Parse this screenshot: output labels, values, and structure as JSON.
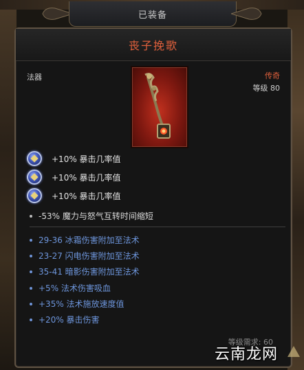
{
  "header": {
    "equipped_label": "已装备"
  },
  "item": {
    "name": "丧子挽歌",
    "type": "法器",
    "rarity": "传奇",
    "level": "等级 80",
    "icon": "scepter-icon"
  },
  "gem_mods": [
    {
      "text": "+10% 暴击几率值",
      "icon": "blue-gem-icon"
    },
    {
      "text": "+10% 暴击几率值",
      "icon": "blue-gem-icon"
    },
    {
      "text": "+10% 暴击几率值",
      "icon": "blue-gem-icon"
    }
  ],
  "implicit_mods": [
    {
      "text": "-53% 魔力与怒气互转时间缩短"
    }
  ],
  "affixes": [
    {
      "text": "29-36 冰霜伤害附加至法术"
    },
    {
      "text": "23-27 闪电伤害附加至法术"
    },
    {
      "text": "35-41 暗影伤害附加至法术"
    },
    {
      "text": "+5% 法术伤害吸血"
    },
    {
      "text": "+35% 法术施放速度值"
    },
    {
      "text": "+20% 暴击伤害"
    }
  ],
  "requirement": "等级需求: 60",
  "watermark": "云南龙网",
  "colors": {
    "legendary": "#e0603c",
    "affix_blue": "#6d95db",
    "frame_bronze": "#5f5243"
  }
}
